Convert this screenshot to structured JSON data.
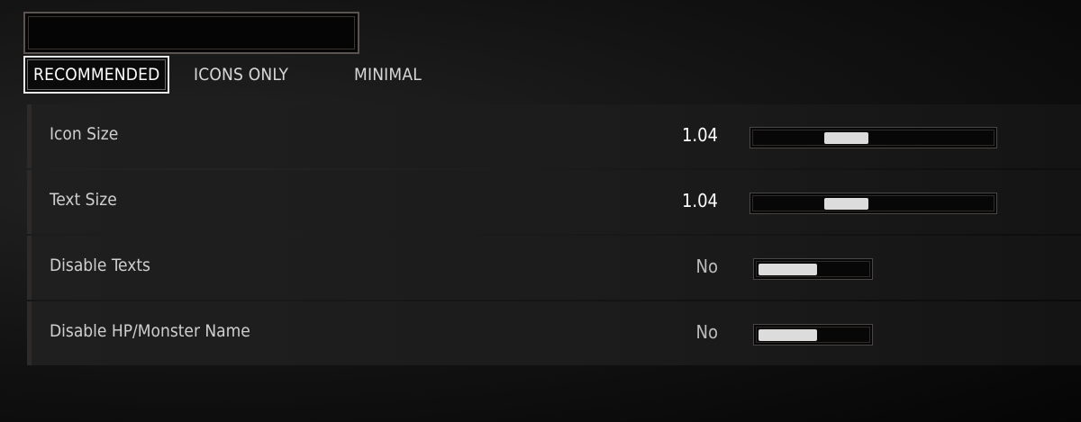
{
  "title_frame": {
    "text": ""
  },
  "tabs": [
    {
      "label": "RECOMMENDED",
      "active": true
    },
    {
      "label": "ICONS ONLY",
      "active": false
    },
    {
      "label": "MINIMAL",
      "active": false
    }
  ],
  "settings": [
    {
      "label": "Icon Size",
      "value": "1.04",
      "control": "slider",
      "level": 0.36
    },
    {
      "label": "Text Size",
      "value": "1.04",
      "control": "slider",
      "level": 0.36
    },
    {
      "label": "Disable Texts",
      "value": "No",
      "control": "toggle",
      "state": "off"
    },
    {
      "label": "Disable HP/Monster Name",
      "value": "No",
      "control": "toggle",
      "state": "off"
    }
  ]
}
